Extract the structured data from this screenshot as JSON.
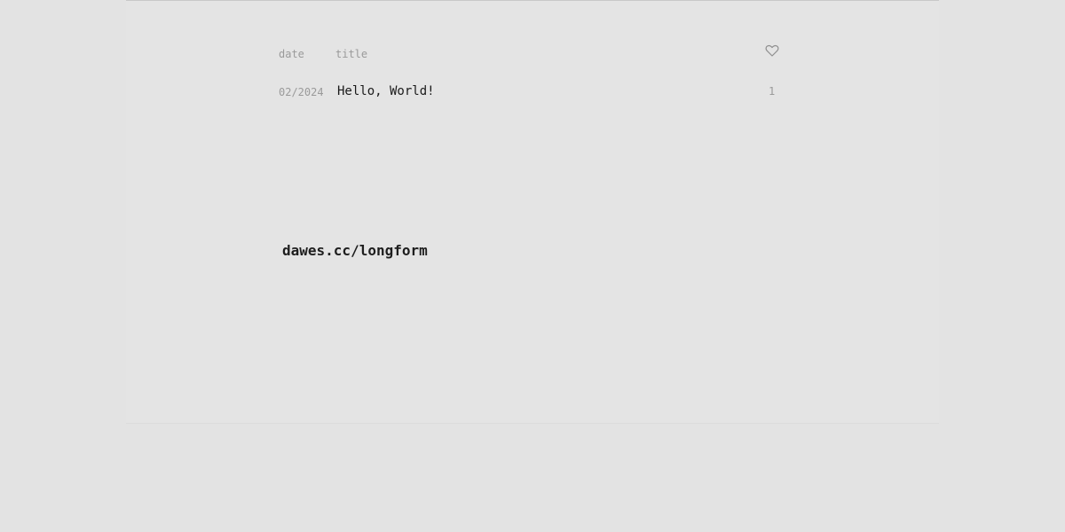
{
  "table": {
    "header": {
      "date_label": "date",
      "title_label": "title",
      "likes_icon": "heart-icon"
    },
    "posts": [
      {
        "date": "02/2024",
        "title": "Hello, World!",
        "likes": "1"
      }
    ]
  },
  "footer": {
    "site_link": "dawes.cc/longform"
  },
  "colors": {
    "background": "#e3e3e3",
    "text_primary": "#1a1a1a",
    "text_muted": "#9a9a9a"
  }
}
